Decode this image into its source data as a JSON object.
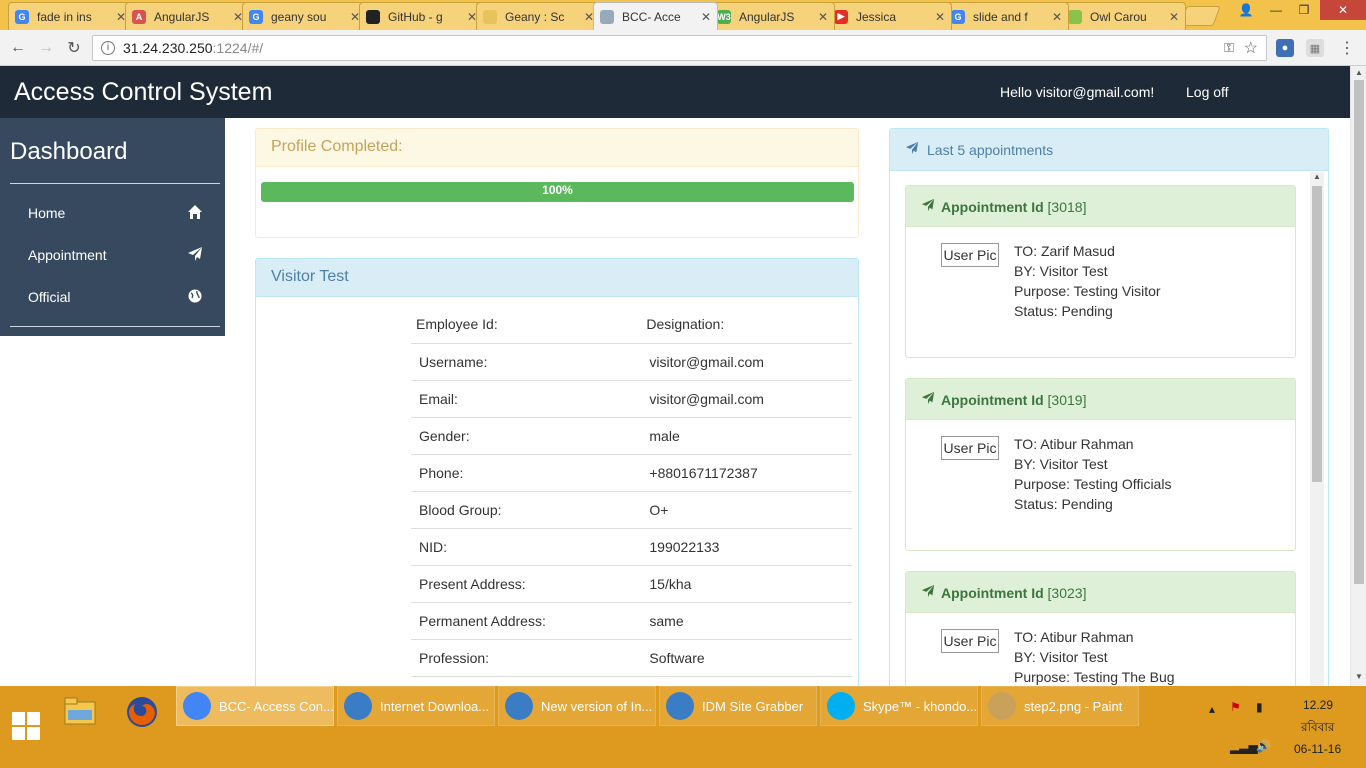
{
  "browser": {
    "tabs": [
      {
        "label": "fade in ins",
        "fav": "G",
        "favcolor": "#4285f4"
      },
      {
        "label": "AngularJS",
        "fav": "A",
        "favcolor": "#d9534f"
      },
      {
        "label": "geany sou",
        "fav": "G",
        "favcolor": "#4285f4"
      },
      {
        "label": "GitHub - g",
        "fav": "",
        "favcolor": "#222222"
      },
      {
        "label": "Geany : Sc",
        "fav": "",
        "favcolor": "#e8c25a"
      },
      {
        "label": "BCC- Acce",
        "fav": "",
        "favcolor": "#9aa9b8"
      },
      {
        "label": "AngularJS",
        "fav": "W3",
        "favcolor": "#4caf50"
      },
      {
        "label": "Jessica",
        "fav": "▶",
        "favcolor": "#e52d27"
      },
      {
        "label": "slide and f",
        "fav": "G",
        "favcolor": "#4285f4"
      },
      {
        "label": "Owl Carou",
        "fav": "",
        "favcolor": "#8bc34a"
      }
    ],
    "address": {
      "host": "31.24.230.250",
      "rest": ":1224/#/"
    }
  },
  "app": {
    "brand": "Access Control System",
    "hello": "Hello visitor@gmail.com!",
    "logoff": "Log off"
  },
  "sidebar": {
    "title": "Dashboard",
    "items": [
      {
        "label": "Home",
        "icon": "home-icon"
      },
      {
        "label": "Appointment",
        "icon": "paper-plane-icon"
      },
      {
        "label": "Official",
        "icon": "globe-icon"
      }
    ]
  },
  "profile": {
    "title": "Profile Completed:",
    "progress": 100,
    "progress_label": "100%"
  },
  "visitor": {
    "title": "Visitor Test",
    "headers": [
      "Employee Id:",
      "Designation:"
    ],
    "rows": [
      {
        "label": "Username:",
        "value": "visitor@gmail.com"
      },
      {
        "label": "Email:",
        "value": "visitor@gmail.com"
      },
      {
        "label": "Gender:",
        "value": "male"
      },
      {
        "label": "Phone:",
        "value": "+8801671172387"
      },
      {
        "label": "Blood Group:",
        "value": "O+"
      },
      {
        "label": "NID:",
        "value": "199022133"
      },
      {
        "label": "Present Address:",
        "value": "15/kha"
      },
      {
        "label": "Permanent Address:",
        "value": "same"
      },
      {
        "label": "Profession:",
        "value": "Software"
      }
    ]
  },
  "appointments": {
    "title": "Last 5 appointments",
    "id_label": "Appointment Id",
    "userpic": "User Pic",
    "items": [
      {
        "id": "[3018]",
        "to": "TO: Zarif Masud",
        "by": "BY: Visitor Test",
        "purpose": "Purpose: Testing Visitor",
        "status": "Status: Pending"
      },
      {
        "id": "[3019]",
        "to": "TO: Atibur Rahman",
        "by": "BY: Visitor Test",
        "purpose": "Purpose: Testing Officials",
        "status": "Status: Pending"
      },
      {
        "id": "[3023]",
        "to": "TO: Atibur Rahman",
        "by": "BY: Visitor Test",
        "purpose": "Purpose: Testing The Bug",
        "status": ""
      }
    ]
  },
  "taskbar": {
    "tasks": [
      {
        "label": "BCC- Access Con...",
        "color": "#4285f4"
      },
      {
        "label": "Internet Downloa...",
        "color": "#3b7dc4"
      },
      {
        "label": "New version of In...",
        "color": "#3b7dc4"
      },
      {
        "label": "IDM Site Grabber",
        "color": "#3b7dc4"
      },
      {
        "label": "Skype™ - khondo...",
        "color": "#00aff0"
      },
      {
        "label": "step2.png - Paint",
        "color": "#c9a15a"
      }
    ],
    "time": "12.29",
    "day": "রবিবার",
    "date": "06-11-16"
  },
  "colors": {
    "navbar": "#1f2a38",
    "sidebar": "#37495f",
    "progress": "#5cb85c",
    "taskbar": "#dd9a1f"
  }
}
